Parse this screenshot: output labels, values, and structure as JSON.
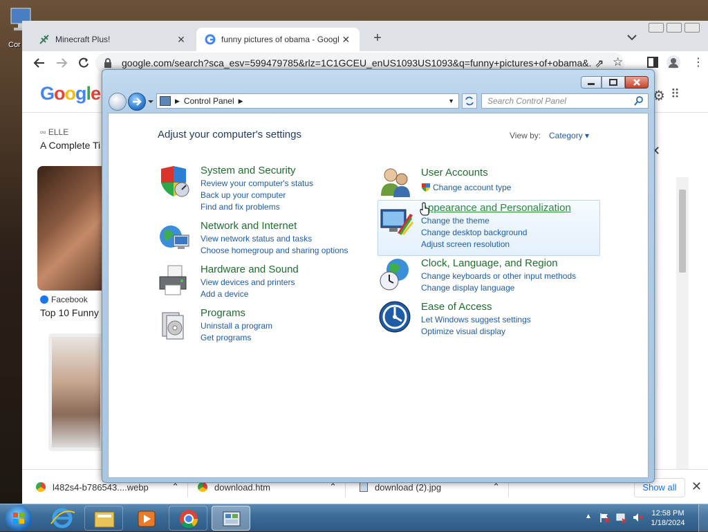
{
  "desktop": {
    "icon_label": "Cor"
  },
  "chrome": {
    "tabs": [
      {
        "title": "Minecraft Plus!"
      },
      {
        "title": "funny pictures of obama - Googl"
      }
    ],
    "url": "google.com/search?sca_esv=599479785&rlz=1C1GCEU_enUS1093US1093&q=funny+pictures+of+obama&...",
    "google_logo": "Google",
    "results": [
      {
        "source": "ELLE",
        "title": "A Complete Ti"
      },
      {
        "source": "Facebook",
        "title": "Top 10 Funny"
      }
    ],
    "downloads": [
      {
        "name": "l482s4-b786543....webp"
      },
      {
        "name": "download.htm"
      },
      {
        "name": "download (2).jpg"
      }
    ],
    "show_all": "Show all"
  },
  "control_panel": {
    "breadcrumb": "Control Panel",
    "search_placeholder": "Search Control Panel",
    "heading": "Adjust your computer's settings",
    "view_by_label": "View by:",
    "view_by_value": "Category",
    "categories_left": [
      {
        "title": "System and Security",
        "links": [
          "Review your computer's status",
          "Back up your computer",
          "Find and fix problems"
        ]
      },
      {
        "title": "Network and Internet",
        "links": [
          "View network status and tasks",
          "Choose homegroup and sharing options"
        ]
      },
      {
        "title": "Hardware and Sound",
        "links": [
          "View devices and printers",
          "Add a device"
        ]
      },
      {
        "title": "Programs",
        "links": [
          "Uninstall a program",
          "Get programs"
        ]
      }
    ],
    "categories_right": [
      {
        "title": "User Accounts",
        "links": [
          "Change account type"
        ]
      },
      {
        "title": "Appearance and Personalization",
        "links": [
          "Change the theme",
          "Change desktop background",
          "Adjust screen resolution"
        ]
      },
      {
        "title": "Clock, Language, and Region",
        "links": [
          "Change keyboards or other input methods",
          "Change display language"
        ]
      },
      {
        "title": "Ease of Access",
        "links": [
          "Let Windows suggest settings",
          "Optimize visual display"
        ]
      }
    ]
  },
  "taskbar": {
    "time": "12:58 PM",
    "date": "1/18/2024"
  }
}
